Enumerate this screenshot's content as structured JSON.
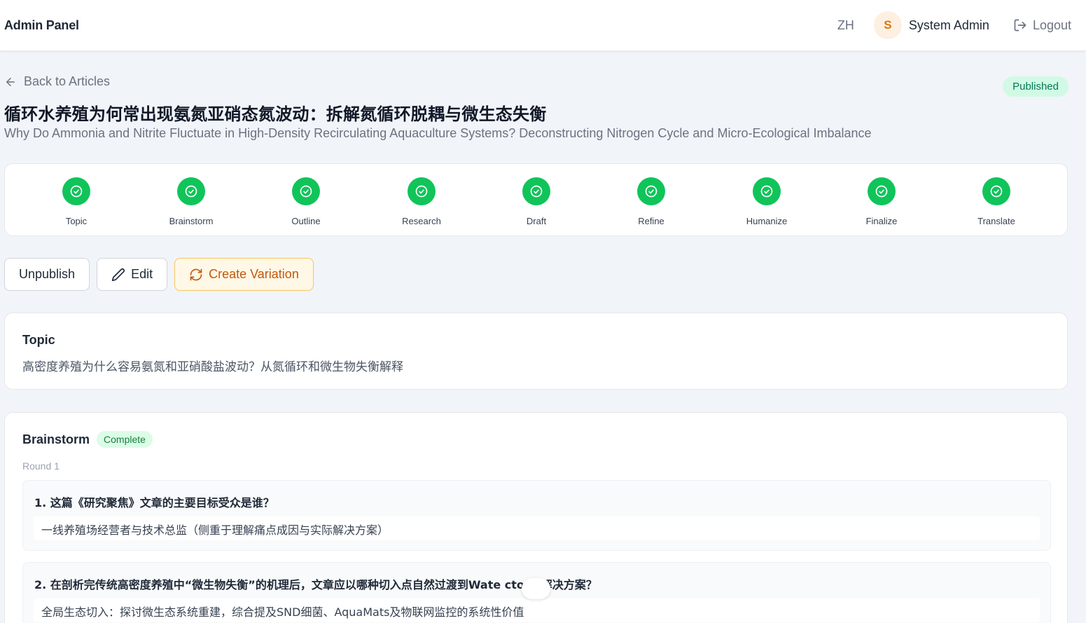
{
  "header": {
    "brand": "Admin Panel",
    "lang": "ZH",
    "avatar_initial": "S",
    "username": "System Admin",
    "logout": "Logout"
  },
  "article": {
    "back_label": "Back to Articles",
    "status": "Published",
    "title_zh": "循环水养殖为何常出现氨氮亚硝态氮波动：拆解氮循环脱耦与微生态失衡",
    "title_en": "Why Do Ammonia and Nitrite Fluctuate in High-Density Recirculating Aquaculture Systems? Deconstructing Nitrogen Cycle and Micro-Ecological Imbalance"
  },
  "steps": [
    {
      "label": "Topic",
      "icon": "check-circle-icon"
    },
    {
      "label": "Brainstorm",
      "icon": "check-circle-icon"
    },
    {
      "label": "Outline",
      "icon": "check-circle-icon"
    },
    {
      "label": "Research",
      "icon": "check-circle-icon"
    },
    {
      "label": "Draft",
      "icon": "check-circle-icon"
    },
    {
      "label": "Refine",
      "icon": "check-circle-icon"
    },
    {
      "label": "Humanize",
      "icon": "check-circle-icon"
    },
    {
      "label": "Finalize",
      "icon": "check-circle-icon"
    },
    {
      "label": "Translate",
      "icon": "check-circle-icon"
    }
  ],
  "actions": {
    "unpublish": "Unpublish",
    "edit": "Edit",
    "create_variation": "Create Variation"
  },
  "topic": {
    "heading": "Topic",
    "text": "高密度养殖为什么容易氨氮和亚硝酸盐波动？从氮循环和微生物失衡解释"
  },
  "brainstorm": {
    "heading": "Brainstorm",
    "status": "Complete",
    "round": "Round 1",
    "items": [
      {
        "question": "1. 这篇《研究聚焦》文章的主要目标受众是谁？",
        "answer": "一线养殖场经营者与技术总监（侧重于理解痛点成因与实际解决方案）"
      },
      {
        "question": "2. 在剖析完传统高密度养殖中“微生物失衡”的机理后，文章应以哪种切入点自然过渡到Wate      ctor的解决方案？",
        "answer": "全局生态切入：探讨微生态系统重建，综合提及SND细菌、AquaMats及物联网监控的系统性价值"
      }
    ]
  },
  "colors": {
    "step_complete": "#10c45a",
    "published_bg": "#d1fae5",
    "variation_accent": "#c2570c"
  }
}
